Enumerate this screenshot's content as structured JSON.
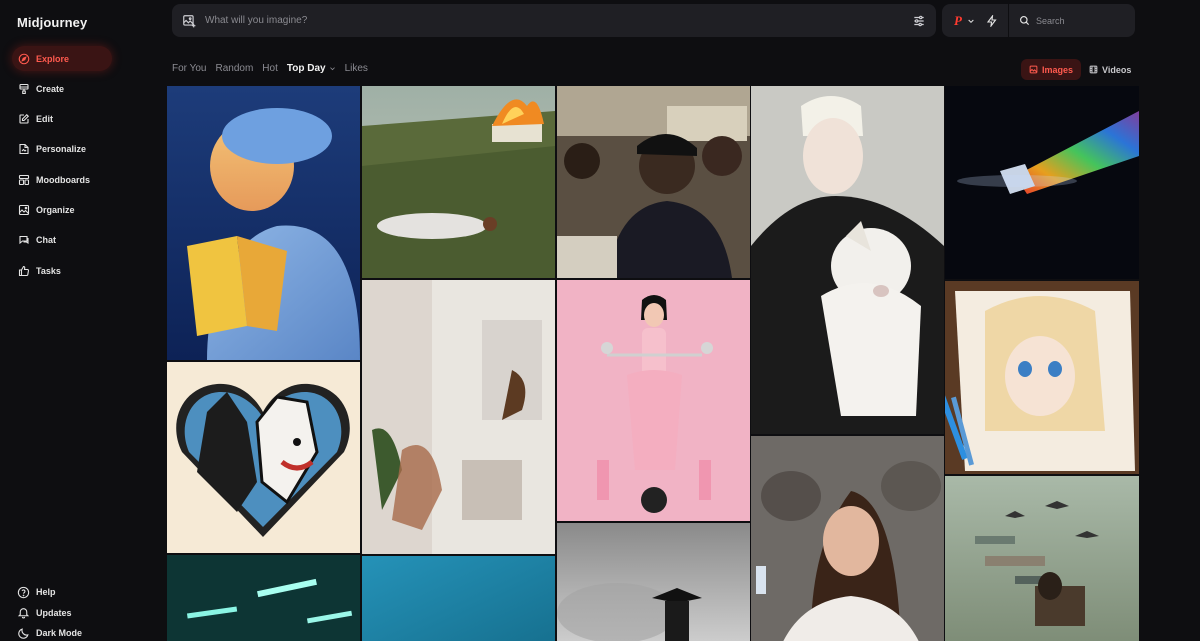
{
  "app": {
    "title": "Midjourney"
  },
  "sidebar": {
    "items": [
      {
        "label": "Explore",
        "icon": "compass-icon",
        "active": true
      },
      {
        "label": "Create",
        "icon": "paintbrush-icon"
      },
      {
        "label": "Edit",
        "icon": "edit-icon"
      },
      {
        "label": "Personalize",
        "icon": "personalize-icon"
      },
      {
        "label": "Moodboards",
        "icon": "moodboard-icon"
      },
      {
        "label": "Organize",
        "icon": "image-icon"
      },
      {
        "label": "Chat",
        "icon": "chat-icon"
      },
      {
        "label": "Tasks",
        "icon": "thumbs-up-icon"
      }
    ],
    "bottom": [
      {
        "label": "Help",
        "icon": "help-icon"
      },
      {
        "label": "Updates",
        "icon": "bell-icon"
      },
      {
        "label": "Dark Mode",
        "icon": "moon-icon"
      }
    ]
  },
  "prompt": {
    "placeholder": "What will you imagine?"
  },
  "search": {
    "placeholder": "Search"
  },
  "profile": {
    "initial": "P",
    "color": "#ff3b30"
  },
  "tabs": [
    {
      "label": "For You"
    },
    {
      "label": "Random"
    },
    {
      "label": "Hot"
    },
    {
      "label": "Top Day",
      "active": true,
      "dropdown": true
    },
    {
      "label": "Likes"
    }
  ],
  "media_types": [
    {
      "label": "Images",
      "active": true
    },
    {
      "label": "Videos"
    }
  ],
  "colors": {
    "accent": "#ff5a4e",
    "background": "#0e0e11",
    "panel": "#1f1f24"
  }
}
